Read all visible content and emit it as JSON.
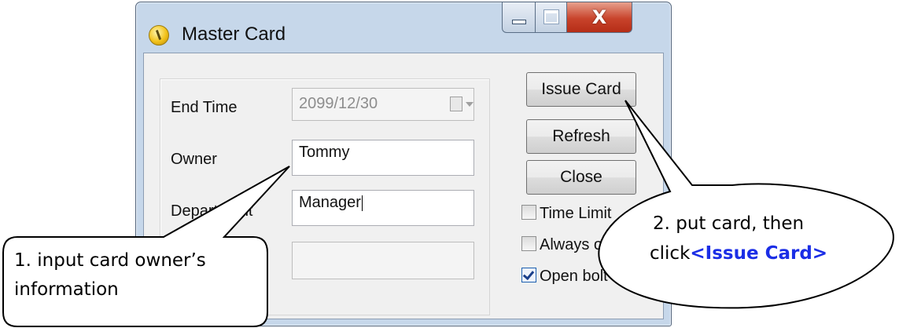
{
  "window": {
    "title": "Master Card",
    "minimize_label": "",
    "maximize_label": "",
    "close_glyph": "X"
  },
  "form": {
    "end_time_label": "End Time",
    "end_time_value": "2099/12/30",
    "owner_label": "Owner",
    "owner_value": "Tommy",
    "department_label": "Department",
    "department_value": "Manager",
    "extra_value": ""
  },
  "buttons": {
    "issue_card": "Issue Card",
    "refresh": "Refresh",
    "close": "Close"
  },
  "options": [
    {
      "label": "Time Limit",
      "checked": false
    },
    {
      "label": "Always open",
      "checked": false
    },
    {
      "label": "Open bolt",
      "checked": true
    }
  ],
  "callouts": {
    "left_line1": "1. input card owner’s",
    "left_line2": "information",
    "right_line1": "2. put card, then",
    "right_line2_prefix": "click",
    "right_line2_highlight": "<Issue Card>"
  },
  "colors": {
    "highlight": "#1b2ee6",
    "close_button": "#c8432b"
  },
  "icons": [
    "app-icon",
    "calendar-dropdown-icon",
    "minimize-icon",
    "maximize-icon",
    "close-icon",
    "checkbox-icon"
  ]
}
